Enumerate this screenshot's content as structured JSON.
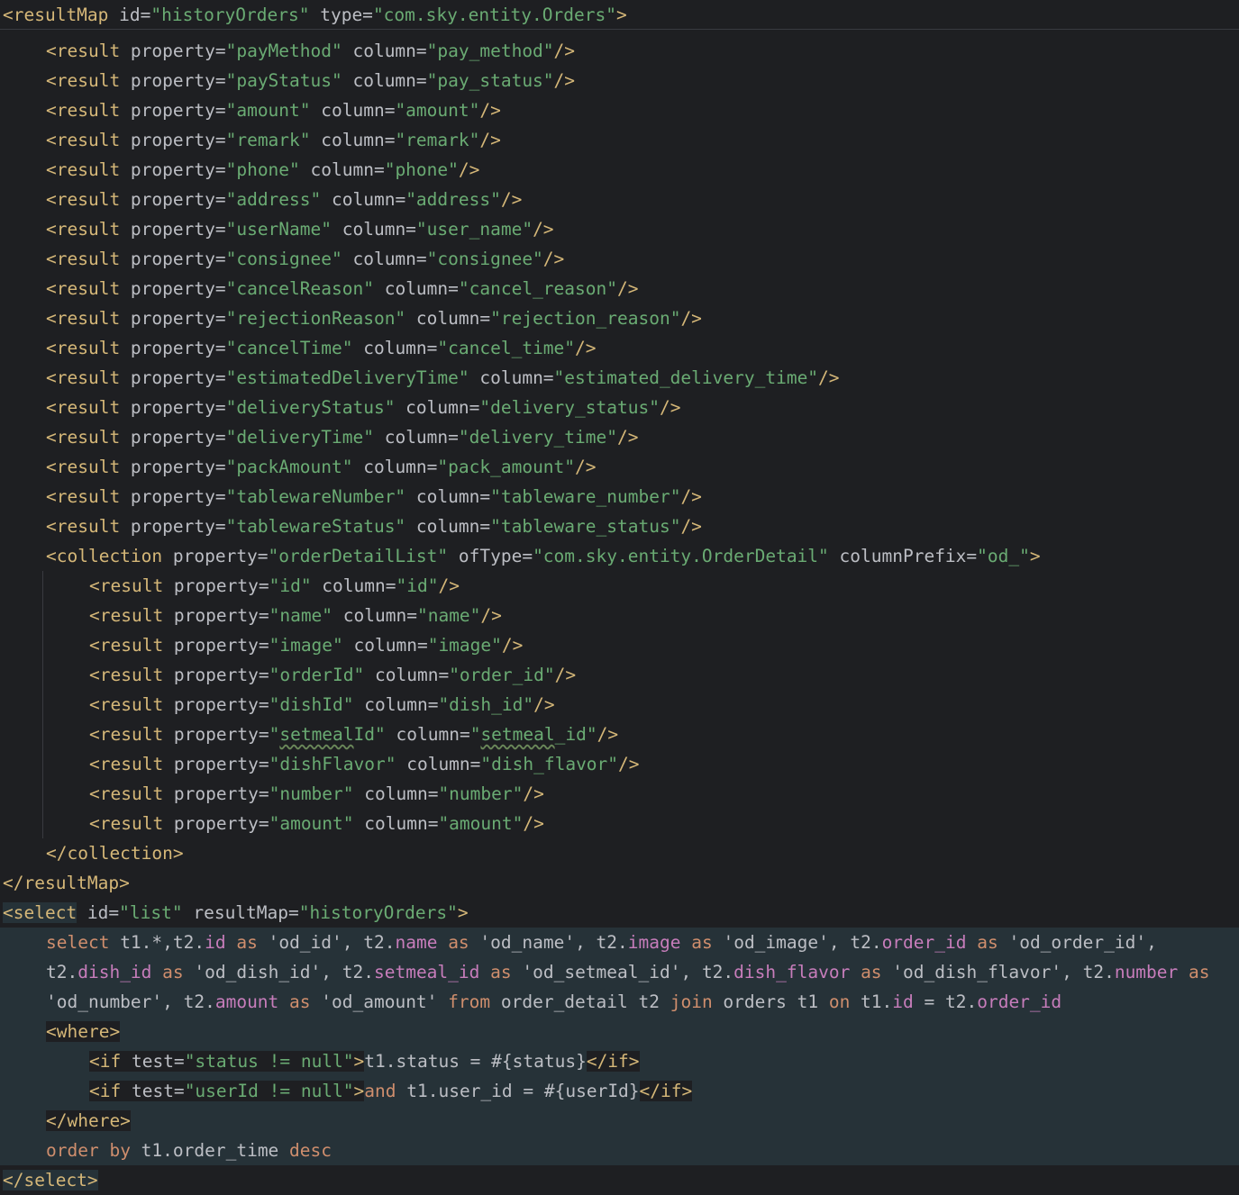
{
  "header": {
    "tag_open": "<resultMap",
    "attr_id": " id=",
    "id_val": "\"historyOrders\"",
    "attr_type": " type=",
    "type_val": "\"com.sky.entity.Orders\"",
    "tag_close": ">"
  },
  "results": [
    {
      "property": "\"payMethod\"",
      "column": "\"pay_method\""
    },
    {
      "property": "\"payStatus\"",
      "column": "\"pay_status\""
    },
    {
      "property": "\"amount\"",
      "column": "\"amount\""
    },
    {
      "property": "\"remark\"",
      "column": "\"remark\""
    },
    {
      "property": "\"phone\"",
      "column": "\"phone\""
    },
    {
      "property": "\"address\"",
      "column": "\"address\""
    },
    {
      "property": "\"userName\"",
      "column": "\"user_name\""
    },
    {
      "property": "\"consignee\"",
      "column": "\"consignee\""
    },
    {
      "property": "\"cancelReason\"",
      "column": "\"cancel_reason\""
    },
    {
      "property": "\"rejectionReason\"",
      "column": "\"rejection_reason\""
    },
    {
      "property": "\"cancelTime\"",
      "column": "\"cancel_time\""
    },
    {
      "property": "\"estimatedDeliveryTime\"",
      "column": "\"estimated_delivery_time\""
    },
    {
      "property": "\"deliveryStatus\"",
      "column": "\"delivery_status\""
    },
    {
      "property": "\"deliveryTime\"",
      "column": "\"delivery_time\""
    },
    {
      "property": "\"packAmount\"",
      "column": "\"pack_amount\""
    },
    {
      "property": "\"tablewareNumber\"",
      "column": "\"tableware_number\""
    },
    {
      "property": "\"tablewareStatus\"",
      "column": "\"tableware_status\""
    }
  ],
  "collection": {
    "tag": "<collection",
    "attr_property": " property=",
    "property_val": "\"orderDetailList\"",
    "attr_oftype": " ofType=",
    "oftype_val": "\"com.sky.entity.OrderDetail\"",
    "attr_prefix": " columnPrefix=",
    "prefix_val": "\"od_\"",
    "tag_end": ">",
    "close": "</collection>",
    "items": [
      {
        "property": "\"id\"",
        "column": "\"id\""
      },
      {
        "property": "\"name\"",
        "column": "\"name\""
      },
      {
        "property": "\"image\"",
        "column": "\"image\""
      },
      {
        "property": "\"orderId\"",
        "column": "\"order_id\""
      },
      {
        "property": "\"dishId\"",
        "column": "\"dish_id\""
      },
      {
        "property": "\"setmealId\"",
        "column": "\"setmeal_id\""
      },
      {
        "property": "\"dishFlavor\"",
        "column": "\"dish_flavor\""
      },
      {
        "property": "\"number\"",
        "column": "\"number\""
      },
      {
        "property": "\"amount\"",
        "column": "\"amount\""
      }
    ]
  },
  "syntax": {
    "result_tag": "<result",
    "property_attr": " property=",
    "column_attr": " column=",
    "self_close": "/>",
    "quote": "\"",
    "setmeal_word": "setmeal",
    "setmeal_prop_rest": "Id\"",
    "setmeal_col_rest": "_id\""
  },
  "resultmap_close": "</resultMap>",
  "select": {
    "tag": "<select",
    "attr_id": " id=",
    "id_val": "\"list\"",
    "attr_rm": " resultMap=",
    "rm_val": "\"historyOrders\"",
    "tag_end": ">",
    "close": "</select>",
    "sql_line1": [
      [
        "kw",
        "select"
      ],
      [
        "plain",
        " t1.*,t2."
      ],
      [
        "fld",
        "id"
      ],
      [
        "plain",
        " "
      ],
      [
        "kw",
        "as"
      ],
      [
        "plain",
        " 'od_id', t2."
      ],
      [
        "fld",
        "name"
      ],
      [
        "plain",
        " "
      ],
      [
        "kw",
        "as"
      ],
      [
        "plain",
        " 'od_name', t2."
      ],
      [
        "fld",
        "image"
      ],
      [
        "plain",
        " "
      ],
      [
        "kw",
        "as"
      ],
      [
        "plain",
        " 'od_image', t2."
      ],
      [
        "fld",
        "order_id"
      ],
      [
        "plain",
        " "
      ],
      [
        "kw",
        "as"
      ],
      [
        "plain",
        " 'od_order_id',"
      ]
    ],
    "sql_line2": [
      [
        "plain",
        "t2."
      ],
      [
        "fld",
        "dish_id"
      ],
      [
        "plain",
        " "
      ],
      [
        "kw",
        "as"
      ],
      [
        "plain",
        " 'od_dish_id', t2."
      ],
      [
        "fld",
        "setmeal_id"
      ],
      [
        "plain",
        " "
      ],
      [
        "kw",
        "as"
      ],
      [
        "plain",
        " 'od_setmeal_id', t2."
      ],
      [
        "fld",
        "dish_flavor"
      ],
      [
        "plain",
        " "
      ],
      [
        "kw",
        "as"
      ],
      [
        "plain",
        " 'od_dish_flavor', t2."
      ],
      [
        "fld",
        "number"
      ],
      [
        "plain",
        " "
      ],
      [
        "kw",
        "as"
      ]
    ],
    "sql_line3": [
      [
        "plain",
        "'od_number', t2."
      ],
      [
        "fld",
        "amount"
      ],
      [
        "plain",
        " "
      ],
      [
        "kw",
        "as"
      ],
      [
        "plain",
        " 'od_amount' "
      ],
      [
        "kw",
        "from"
      ],
      [
        "plain",
        " order_detail t2 "
      ],
      [
        "kw",
        "join"
      ],
      [
        "plain",
        " orders t1 "
      ],
      [
        "kw",
        "on"
      ],
      [
        "plain",
        " t1."
      ],
      [
        "fld",
        "id"
      ],
      [
        "plain",
        " = t2."
      ],
      [
        "fld",
        "order_id"
      ]
    ],
    "where_open": "<where>",
    "where_close": "</where>",
    "if1": {
      "tag": "<if",
      "attr": " test=",
      "val": "\"status != null\"",
      "tag_end": ">",
      "body": "t1.status = #{status}",
      "close": "</if>"
    },
    "if2": {
      "tag": "<if",
      "attr": " test=",
      "val": "\"userId != null\"",
      "tag_end": ">",
      "kw": "and",
      "body": " t1.user_id = #{userId}",
      "close": "</if>"
    },
    "order_kw1": "order",
    "order_kw2": "by",
    "order_mid": " t1.order_time ",
    "order_kw3": "desc"
  }
}
